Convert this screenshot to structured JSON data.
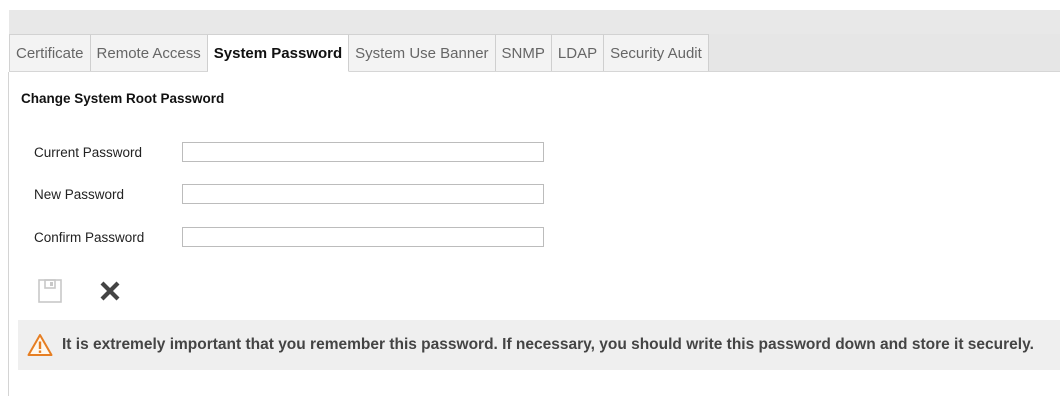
{
  "tabs": [
    {
      "label": "Certificate",
      "active": false
    },
    {
      "label": "Remote Access",
      "active": false
    },
    {
      "label": "System Password",
      "active": true
    },
    {
      "label": "System Use Banner",
      "active": false
    },
    {
      "label": "SNMP",
      "active": false
    },
    {
      "label": "LDAP",
      "active": false
    },
    {
      "label": "Security Audit",
      "active": false
    }
  ],
  "section": {
    "title": "Change System Root Password"
  },
  "form": {
    "current_password": {
      "label": "Current Password",
      "value": ""
    },
    "new_password": {
      "label": "New Password",
      "value": ""
    },
    "confirm_password": {
      "label": "Confirm Password",
      "value": ""
    }
  },
  "actions": {
    "save": {
      "icon": "save-icon",
      "enabled": false
    },
    "cancel": {
      "icon": "close-icon",
      "enabled": true
    }
  },
  "warning": {
    "icon": "warning-icon",
    "message": "It is extremely important that you remember this password. If necessary, you should write this password down and store it securely."
  },
  "colors": {
    "warning_icon": "#e67e22",
    "cancel_icon": "#444444",
    "save_icon_disabled": "#c8c8c8"
  }
}
